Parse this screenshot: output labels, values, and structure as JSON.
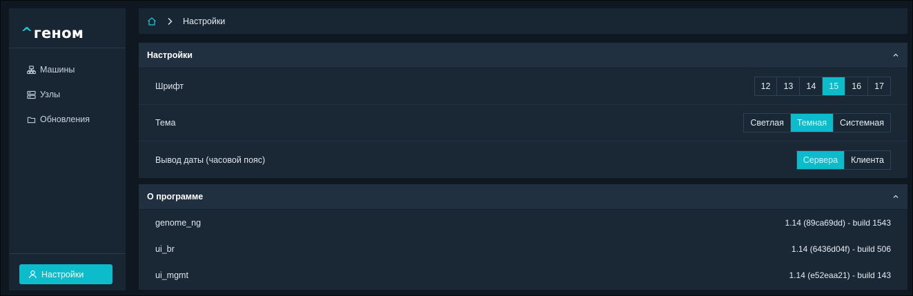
{
  "sidebar": {
    "logo_caret": "^",
    "logo_text": "геном",
    "items": [
      {
        "label": "Машины",
        "icon": "server-tree-icon"
      },
      {
        "label": "Узлы",
        "icon": "nodes-icon"
      },
      {
        "label": "Обновления",
        "icon": "folder-icon"
      }
    ],
    "settings_button": {
      "label": "Настройки",
      "icon": "user-icon"
    }
  },
  "breadcrumb": {
    "home_icon": "home-icon",
    "separator": ">",
    "current": "Настройки"
  },
  "settings_panel": {
    "title": "Настройки",
    "font_label": "Шрифт",
    "font_options": [
      "12",
      "13",
      "14",
      "15",
      "16",
      "17"
    ],
    "font_selected": "15",
    "theme_label": "Тема",
    "theme_options": [
      "Светлая",
      "Темная",
      "Системная"
    ],
    "theme_selected": "Темная",
    "date_label": "Вывод даты (часовой пояс)",
    "date_options": [
      "Сервера",
      "Клиента"
    ],
    "date_selected": "Сервера"
  },
  "about_panel": {
    "title": "О программе",
    "rows": [
      {
        "name": "genome_ng",
        "value": "1.14 (89ca69dd) - build 1543"
      },
      {
        "name": "ui_br",
        "value": "1.14 (6436d04f) - build 506"
      },
      {
        "name": "ui_mgmt",
        "value": "1.14 (e52eaa21) - build 143"
      }
    ]
  },
  "colors": {
    "accent": "#0cbccb",
    "background": "#0f1821",
    "panel": "#1a2735",
    "panel_header": "#203041"
  }
}
